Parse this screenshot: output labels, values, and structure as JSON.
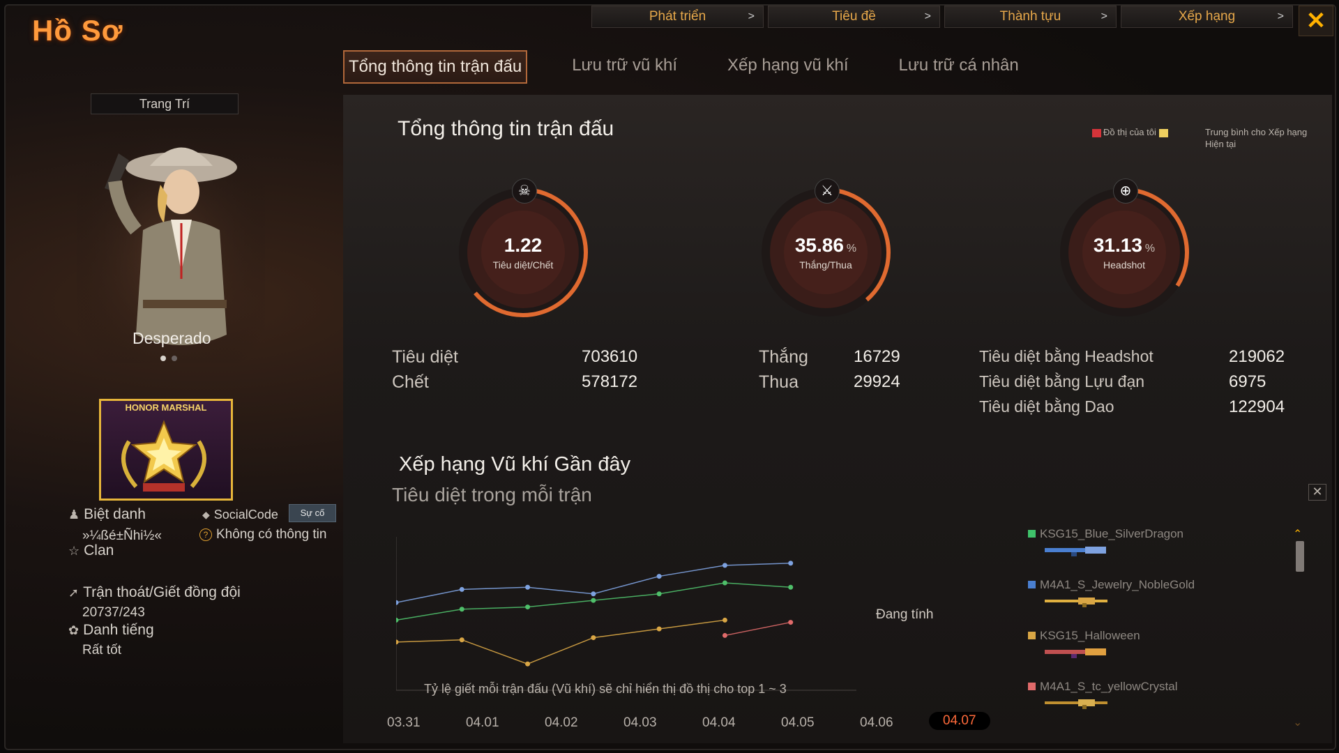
{
  "header": {
    "title": "Hồ Sơ",
    "top_tabs": [
      "Phát triển",
      "Tiêu đề",
      "Thành tựu",
      "Xếp hạng"
    ],
    "close_symbol": "✕"
  },
  "main_tabs": [
    "Tổng thông tin trận đấu",
    "Lưu trữ vũ khí",
    "Xếp hạng vũ khí",
    "Lưu trữ cá nhân"
  ],
  "left": {
    "decorate_label": "Trang Trí",
    "character_name": "Desperado",
    "badge_text": "HONOR MARSHAL",
    "nickname_label": "Biệt danh",
    "nickname_value": "»¼ßé±Ñhi½«",
    "socialcode_label": "SocialCode",
    "socialcode_button": "Sự cố",
    "socialcode_value": "Không có thông tin",
    "clan_label": "Clan",
    "escape_label": "Trận thoát/Giết đồng đội",
    "escape_value": "20737/243",
    "reputation_label": "Danh tiếng",
    "reputation_value": "Rất tốt"
  },
  "summary": {
    "title": "Tổng thông tin trận đấu",
    "legend_mine": "Đồ thị của tôi",
    "legend_avg": "Trung bình cho Xếp hạng Hiện tại",
    "gauges": [
      {
        "value": "1.22",
        "unit": "",
        "label": "Tiêu diệt/Chết",
        "fill": 0.61
      },
      {
        "value": "35.86",
        "unit": "%",
        "label": "Thắng/Thua",
        "fill": 0.3586
      },
      {
        "value": "31.13",
        "unit": "%",
        "label": "Headshot",
        "fill": 0.3113
      }
    ],
    "stats_a": [
      {
        "label": "Tiêu diệt",
        "value": "703610"
      },
      {
        "label": "Chết",
        "value": "578172"
      }
    ],
    "stats_b": [
      {
        "label": "Thắng",
        "value": "16729"
      },
      {
        "label": "Thua",
        "value": "29924"
      }
    ],
    "stats_c": [
      {
        "label": "Tiêu diệt bằng Headshot",
        "value": "219062"
      },
      {
        "label": "Tiêu diệt bằng Lựu đạn",
        "value": "6975"
      },
      {
        "label": "Tiêu diệt bằng Dao",
        "value": "122904"
      }
    ]
  },
  "recent": {
    "title": "Xếp hạng Vũ khí Gần đây",
    "subtitle": "Tiêu diệt trong mỗi trận",
    "calculating": "Đang tính",
    "note": "Tỷ lệ giết mỗi trận đấu (Vũ khí) sẽ chỉ hiển thị đồ thị cho top 1 ~ 3",
    "weapons": [
      {
        "name": "KSG15_Blue_SilverDragon",
        "color": "#3fc26a"
      },
      {
        "name": "M4A1_S_Jewelry_NobleGold",
        "color": "#4a7fd0"
      },
      {
        "name": "KSG15_Halloween",
        "color": "#d9a645"
      },
      {
        "name": "M4A1_S_tc_yellowCrystal",
        "color": "#e06a6a"
      }
    ]
  },
  "chart_data": {
    "type": "line",
    "categories": [
      "03.31",
      "04.01",
      "04.02",
      "04.03",
      "04.04",
      "04.05",
      "04.06",
      "04.07"
    ],
    "selected_category": "04.07",
    "series": [
      {
        "name": "KSG15_Blue_SilverDragon",
        "color": "#7ea2e0",
        "values": [
          2.0,
          2.3,
          2.35,
          2.2,
          2.6,
          2.85,
          2.9,
          null
        ]
      },
      {
        "name": "M4A1_S_Jewelry_NobleGold",
        "color": "#4fbf6a",
        "values": [
          1.6,
          1.85,
          1.9,
          2.05,
          2.2,
          2.45,
          2.35,
          null
        ]
      },
      {
        "name": "KSG15_Halloween",
        "color": "#d9a645",
        "values": [
          1.1,
          1.15,
          0.6,
          1.2,
          1.4,
          1.6,
          null,
          null
        ]
      },
      {
        "name": "M4A1_S_tc_yellowCrystal",
        "color": "#e06a6a",
        "values": [
          null,
          null,
          null,
          null,
          null,
          1.25,
          1.55,
          null
        ]
      }
    ],
    "ylim": [
      0,
      3.5
    ]
  }
}
